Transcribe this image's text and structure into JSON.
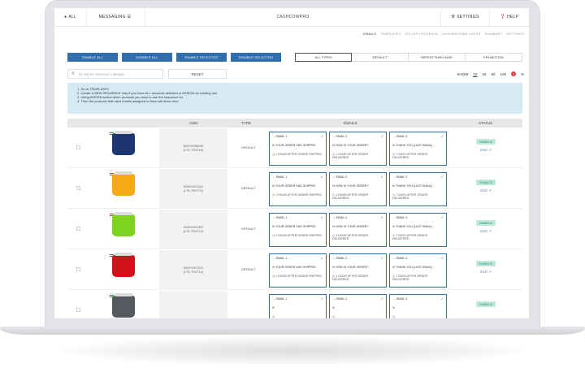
{
  "topnav": {
    "all_label": "ALL",
    "messaging_label": "MESSAGING",
    "app_title": "CASHCOWPRO",
    "settings_label": "SETTINGS",
    "help_label": "HELP"
  },
  "subnav": [
    "EMAILS",
    "TEMPLATES",
    "SELLER FEEDBACK",
    "UNSUBSCRIBE USERS",
    "SUMMARY",
    "SETTINGS"
  ],
  "actions": {
    "enable_all": "ENABLE ALL",
    "disable_all": "DISABLE ALL",
    "enable_selected": "ENABLE SELECTED",
    "disable_selected": "DISABLE SELECTED"
  },
  "type_tabs": [
    "ALL TYPES",
    "DEFAULT",
    "REPEAT PURCHASE",
    "PROMOTION"
  ],
  "filter": {
    "placeholder": "FILTER BY PRODUCT, BRAND",
    "reset_label": "RESET"
  },
  "show": {
    "label": "SHOW",
    "options": [
      "10",
      "25",
      "50",
      "100"
    ],
    "selected": "10"
  },
  "instructions": [
    "1. Go to TEMPLATES",
    "2. Create a NEW SEQUENCE only if you have ALL accounts selected or ASSIGN an existing one",
    "3. Using ASSIGN select which products you want to use the sequence for",
    "4. Then the products that have emails assigned to them will show here"
  ],
  "table": {
    "headers": [
      "ASIN",
      "TYPE",
      "EMAILS",
      "STATUS"
    ],
    "rows": [
      {
        "asin": "B00XXMBAK8",
        "sub": "(LTK-TRVT18)",
        "type": "DEFAULT",
        "status": "ENABLED",
        "edit": "EDIT",
        "emails": [
          {
            "title": "EMAIL 1",
            "subject": "YOUR ORDER HAS SHIPPED",
            "timing": "1 HOUR AFTER ORDER SHIPPED"
          },
          {
            "title": "EMAIL 2",
            "subject": "HOW IS YOUR ORDER?",
            "timing": "1 HOUR AFTER ORDER DELIVERED"
          },
          {
            "title": "EMAIL 3",
            "subject": "THANK YOU (LAST EMAIL)",
            "timing": "7 DAYS AFTER ORDER DELIVERED"
          }
        ]
      },
      {
        "asin": "B00XX4C2Q2",
        "sub": "(LTK-TRVT11)",
        "type": "DEFAULT",
        "status": "ENABLED",
        "edit": "EDIT",
        "emails": [
          {
            "title": "EMAIL 1",
            "subject": "YOUR ORDER HAS SHIPPED",
            "timing": "1 HOUR AFTER ORDER SHIPPED"
          },
          {
            "title": "EMAIL 2",
            "subject": "HOW IS YOUR ORDER?",
            "timing": "1 HOUR AFTER ORDER DELIVERED"
          },
          {
            "title": "EMAIL 3",
            "subject": "THANK YOU (LAST EMAIL)",
            "timing": "7 DAYS AFTER ORDER DELIVERED"
          }
        ]
      },
      {
        "asin": "B00XX4C2B0",
        "sub": "(LTK-TRVT12)",
        "type": "DEFAULT",
        "status": "ENABLED",
        "edit": "EDIT",
        "emails": [
          {
            "title": "EMAIL 1",
            "subject": "YOUR ORDER HAS SHIPPED",
            "timing": "1 HOUR AFTER ORDER SHIPPED"
          },
          {
            "title": "EMAIL 2",
            "subject": "HOW IS YOUR ORDER?",
            "timing": "1 HOUR AFTER ORDER DELIVERED"
          },
          {
            "title": "EMAIL 3",
            "subject": "THANK YOU (LAST EMAIL)",
            "timing": "7 DAYS AFTER ORDER DELIVERED"
          }
        ]
      },
      {
        "asin": "B00XX4C2D3",
        "sub": "(LTK-TRVT14)",
        "type": "DEFAULT",
        "status": "ENABLED",
        "edit": "EDIT",
        "emails": [
          {
            "title": "EMAIL 1",
            "subject": "YOUR ORDER HAS SHIPPED",
            "timing": "1 HOUR AFTER ORDER SHIPPED"
          },
          {
            "title": "EMAIL 2",
            "subject": "HOW IS YOUR ORDER?",
            "timing": "1 HOUR AFTER ORDER DELIVERED"
          },
          {
            "title": "EMAIL 3",
            "subject": "THANK YOU (LAST EMAIL)",
            "timing": "7 DAYS AFTER ORDER DELIVERED"
          }
        ]
      },
      {
        "asin": "",
        "sub": "",
        "type": "",
        "status": "ENABLED",
        "edit": "",
        "emails": [
          {
            "title": "EMAIL 1",
            "subject": "",
            "timing": ""
          },
          {
            "title": "EMAIL 2",
            "subject": "",
            "timing": ""
          },
          {
            "title": "EMAIL 3",
            "subject": "",
            "timing": ""
          }
        ]
      }
    ]
  },
  "colors": {
    "primary": "#2f6fb0",
    "info_bg": "#d6eaf6",
    "enabled_bg": "#bfeadb",
    "enabled_text": "#2e8a6a",
    "products": [
      "#1d3672",
      "#f6a815",
      "#7ed321",
      "#d0121b",
      "#555a60"
    ]
  }
}
